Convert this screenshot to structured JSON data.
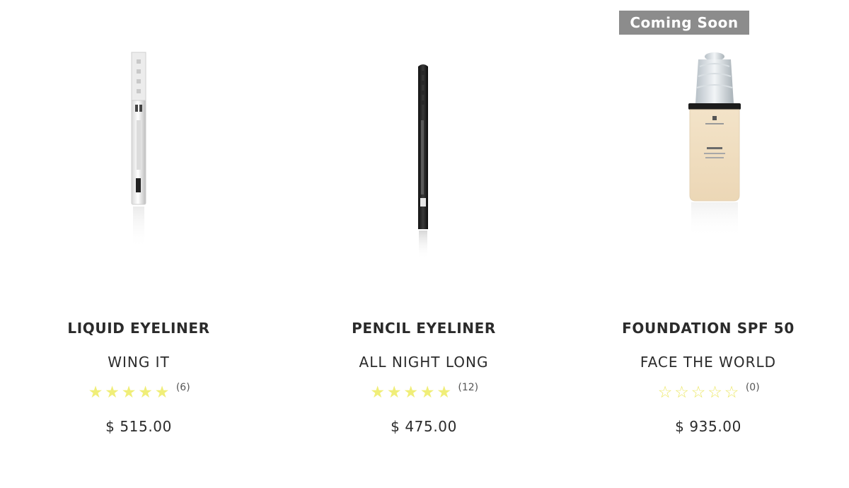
{
  "products": [
    {
      "title": "LIQUID EYELINER",
      "subtitle": "WING IT",
      "stars": [
        "★",
        "★",
        "★",
        "★",
        "★"
      ],
      "review_count": "(6)",
      "price": "$ 515.00",
      "image_icon": "liquid-eyeliner-pen-icon"
    },
    {
      "title": "PENCIL EYELINER",
      "subtitle": "ALL NIGHT LONG",
      "stars": [
        "★",
        "★",
        "★",
        "★",
        "★"
      ],
      "review_count": "(12)",
      "price": "$ 475.00",
      "image_icon": "pencil-eyeliner-icon"
    },
    {
      "title": "FOUNDATION SPF 50",
      "subtitle": "FACE THE WORLD",
      "badge": "Coming Soon",
      "stars": [
        "☆",
        "☆",
        "☆",
        "☆",
        "☆"
      ],
      "review_count": "(0)",
      "price": "$ 935.00",
      "image_icon": "foundation-bottle-icon"
    }
  ],
  "colors": {
    "star": "#f0ee78",
    "badge_bg": "#8c8c8c",
    "text": "#2b2b2b"
  }
}
